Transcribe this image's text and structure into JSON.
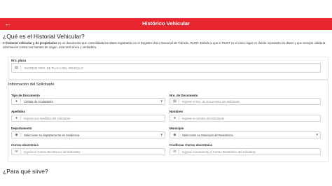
{
  "header": {
    "title": "Histórico Vehicular",
    "back_icon": "arrow-left-icon"
  },
  "intro": {
    "heading": "¿Qué es el Historial Vehicular?",
    "bold_part": "historial vehicular y de propietarios",
    "prefix": "El ",
    "text": " es un documento que consolidada los datos registrados en el Registro Único Nacional de Tránsito, RUNT. Debido a que el RUNT es el único lugar en donde reposarán los datos y que siempre valida la información contra sus fuentes de origen, ésta será única y verdadera."
  },
  "placa": {
    "label": "Nro. placa",
    "placeholder": "INGRESE NRO. DE PLACA DEL VEHÍCULO"
  },
  "solicitante": {
    "section_title": "Información del Solicitante",
    "tipo_documento": {
      "label": "Tipo de Documento",
      "value": "Cédula de Ciudadanía"
    },
    "nro_documento": {
      "label": "Nro. de Documento",
      "placeholder": "Ingrese el Nro. de Documento del solicitante"
    },
    "apellidos": {
      "label": "Apellidos",
      "placeholder": "Ingrese sus Apellidos del solicitante"
    },
    "nombres": {
      "label": "Nombres",
      "placeholder": "Ingrese el nombre del solicitante"
    },
    "departamento": {
      "label": "Departamento",
      "value": "Seleccione su departamento de residencia"
    },
    "municipio": {
      "label": "Municipio",
      "value": "Seleccione su Municipio de Residencia"
    },
    "correo": {
      "label": "Correo electrónico",
      "placeholder": "Ingrese el Correo Electrónico del solicitante"
    },
    "confirmar_correo": {
      "label": "Confirmar Correo electrónico",
      "placeholder": "Ingrese nuevamente el Correo Electrónico del solicitante"
    }
  },
  "footer": {
    "heading": "¿Para qué sirve?"
  },
  "colors": {
    "accent": "#e8262d",
    "border": "#d0d0d0"
  }
}
